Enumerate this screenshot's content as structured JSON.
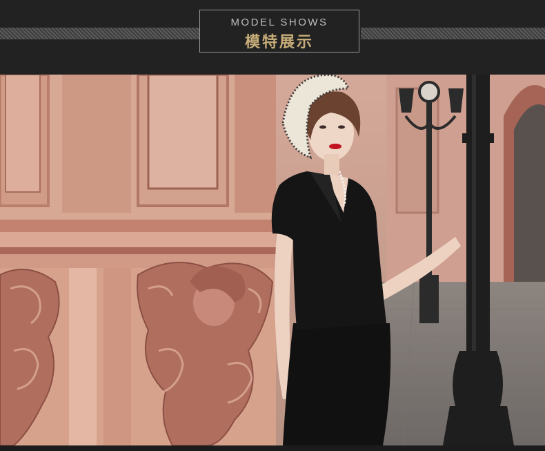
{
  "header": {
    "title_en": "MODEL SHOWS",
    "title_cn": "模特展示"
  },
  "photo": {
    "subject": "model-in-black-suit-photo"
  },
  "colors": {
    "background": "#222222",
    "accent_gold": "#c7ad79",
    "title_gray": "#bdbdbd"
  }
}
